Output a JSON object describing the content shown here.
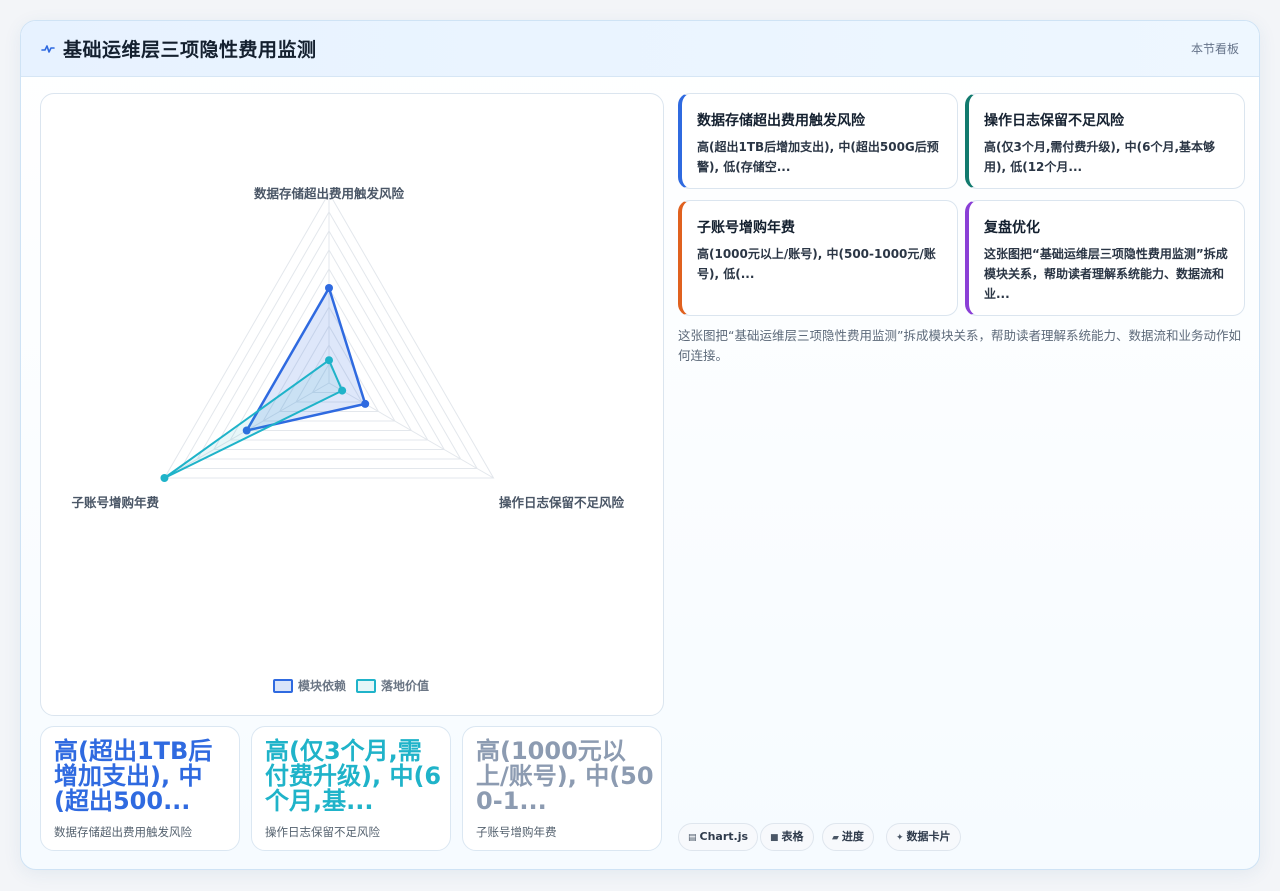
{
  "header": {
    "title": "基础运维层三项隐性费用监测",
    "board_label": "本节看板"
  },
  "colors": {
    "series1": "#2f6ae0",
    "series2": "#1fb3c9",
    "kpi1": "#2f6ae0",
    "kpi2": "#1fb3c9",
    "kpi3": "#8c9bb1",
    "card1": "#2f6ae0",
    "card2": "#127a6e",
    "card3": "#e0611f",
    "card4": "#8a3fd6"
  },
  "chart_data": {
    "type": "radar",
    "axes": [
      "数据存储超出费用触发风险",
      "操作日志保留不足风险",
      "子账号增购年费"
    ],
    "range": [
      0,
      1
    ],
    "series": [
      {
        "name": "模块依赖",
        "values": [
          0.5,
          0.22,
          0.5
        ]
      },
      {
        "name": "落地价值",
        "values": [
          0.12,
          0.08,
          1.0
        ]
      }
    ],
    "legend_position": "bottom"
  },
  "kpis": [
    {
      "value": "高(超出1TB后增加支出), 中(超出500...",
      "label": "数据存储超出费用触发风险"
    },
    {
      "value": "高(仅3个月,需付费升级), 中(6个月,基...",
      "label": "操作日志保留不足风险"
    },
    {
      "value": "高(1000元以上/账号), 中(500-1...",
      "label": "子账号增购年费"
    }
  ],
  "cards": [
    {
      "title": "数据存储超出费用触发风险",
      "desc": "高(超出1TB后增加支出), 中(超出500G后预警), 低(存储空..."
    },
    {
      "title": "操作日志保留不足风险",
      "desc": "高(仅3个月,需付费升级), 中(6个月,基本够用), 低(12个月..."
    },
    {
      "title": "子账号增购年费",
      "desc": "高(1000元以上/账号), 中(500-1000元/账号), 低(..."
    },
    {
      "title": "复盘优化",
      "desc": "这张图把“基础运维层三项隐性费用监测”拆成模块关系，帮助读者理解系统能力、数据流和业..."
    }
  ],
  "note": "这张图把“基础运维层三项隐性费用监测”拆成模块关系，帮助读者理解系统能力、数据流和业务动作如何连接。",
  "tags": [
    {
      "icon": "▤",
      "label": "Chart.js",
      "icon_name": "chart-icon"
    },
    {
      "icon": "■",
      "label": "表格",
      "icon_name": "table-icon"
    },
    {
      "icon": "▰",
      "label": "进度",
      "icon_name": "progress-icon"
    },
    {
      "icon": "✦",
      "label": "数据卡片",
      "icon_name": "sparkle-icon"
    }
  ]
}
